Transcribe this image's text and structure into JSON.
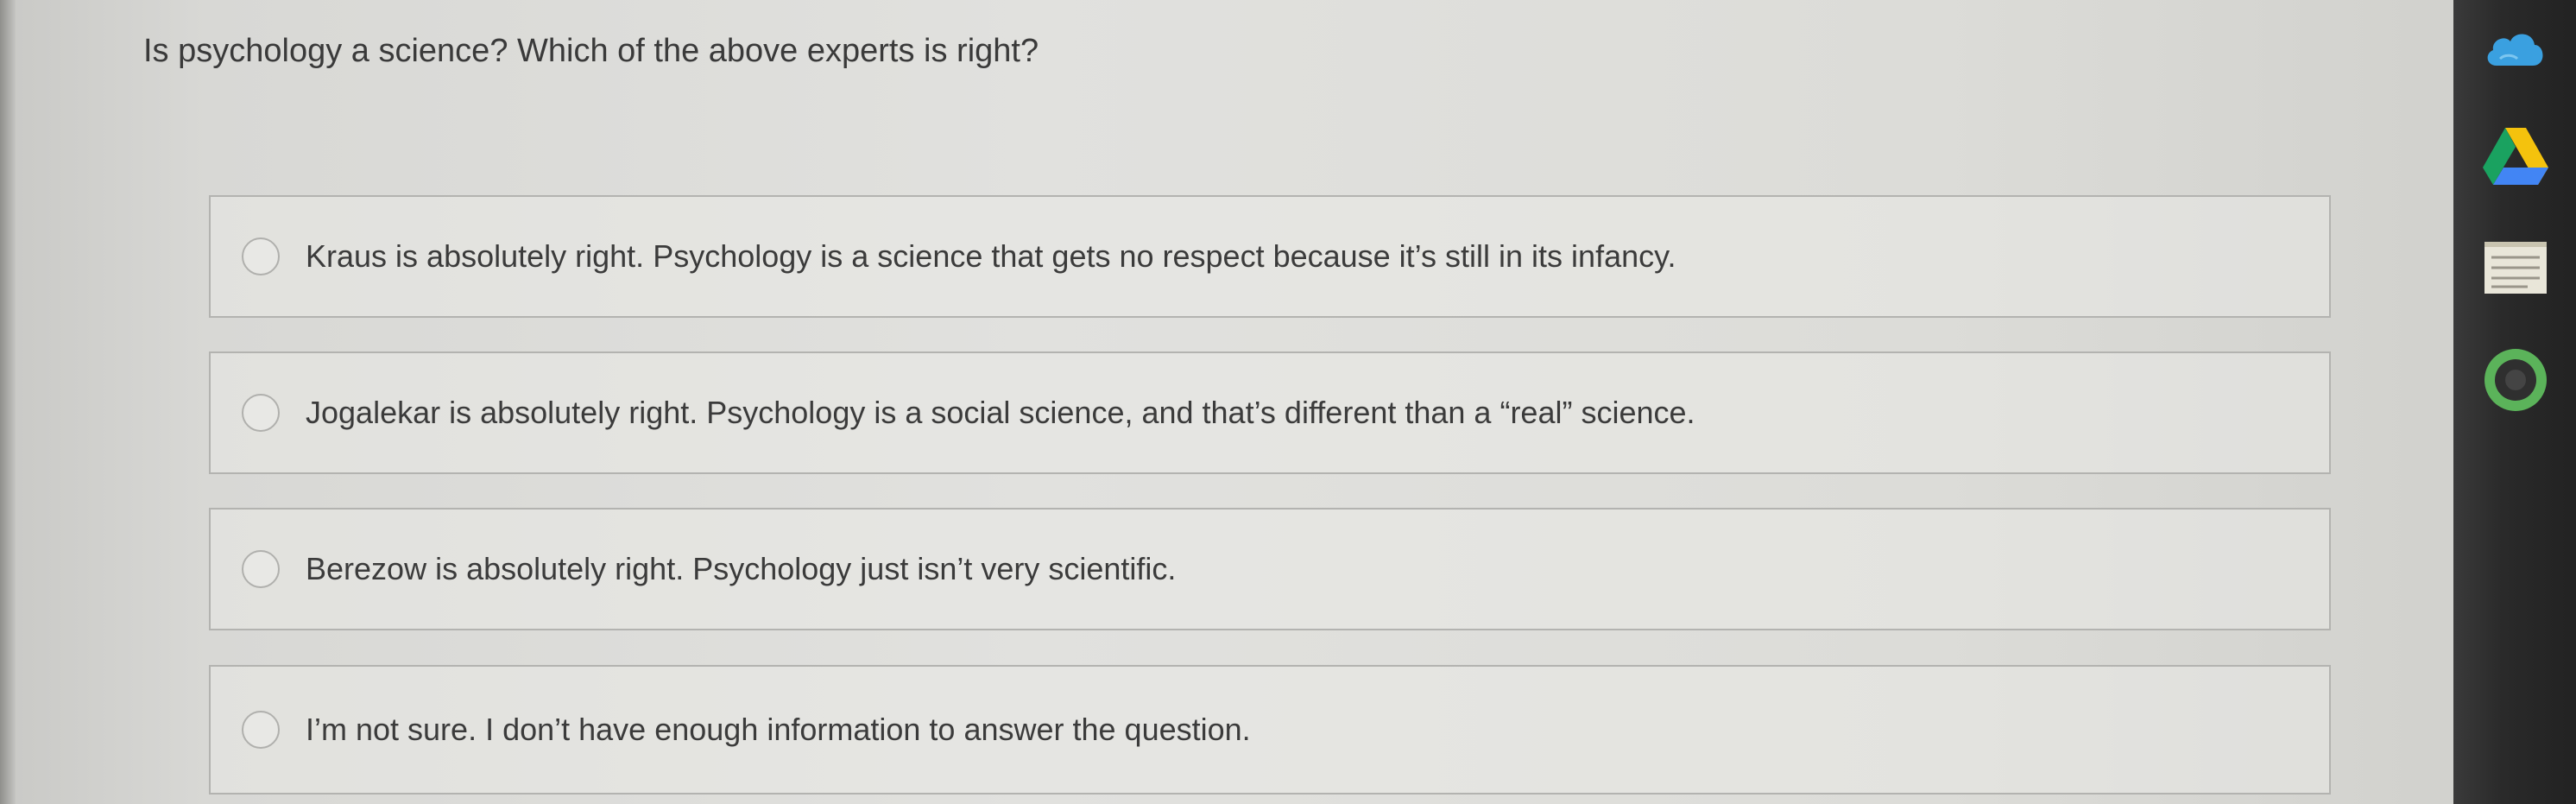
{
  "question": "Is psychology a science? Which of the above experts is right?",
  "options": [
    {
      "label": "Kraus is absolutely right. Psychology is a science that gets no respect because it’s still in its infancy."
    },
    {
      "label": "Jogalekar is absolutely right. Psychology is a social science, and that’s different than a “real” science."
    },
    {
      "label": "Berezow is absolutely right. Psychology just isn’t very scientific."
    },
    {
      "label": "I’m not sure. I don’t have enough information to answer the question."
    }
  ],
  "dock": {
    "icons": [
      "cloud-icon",
      "google-drive-icon",
      "docs-notes-icon",
      "green-circle-app-icon"
    ]
  },
  "colors": {
    "background": "#dedeDB",
    "border": "#b3b3b0",
    "text": "#3b3b3b",
    "dock": "#2a2a2a"
  }
}
